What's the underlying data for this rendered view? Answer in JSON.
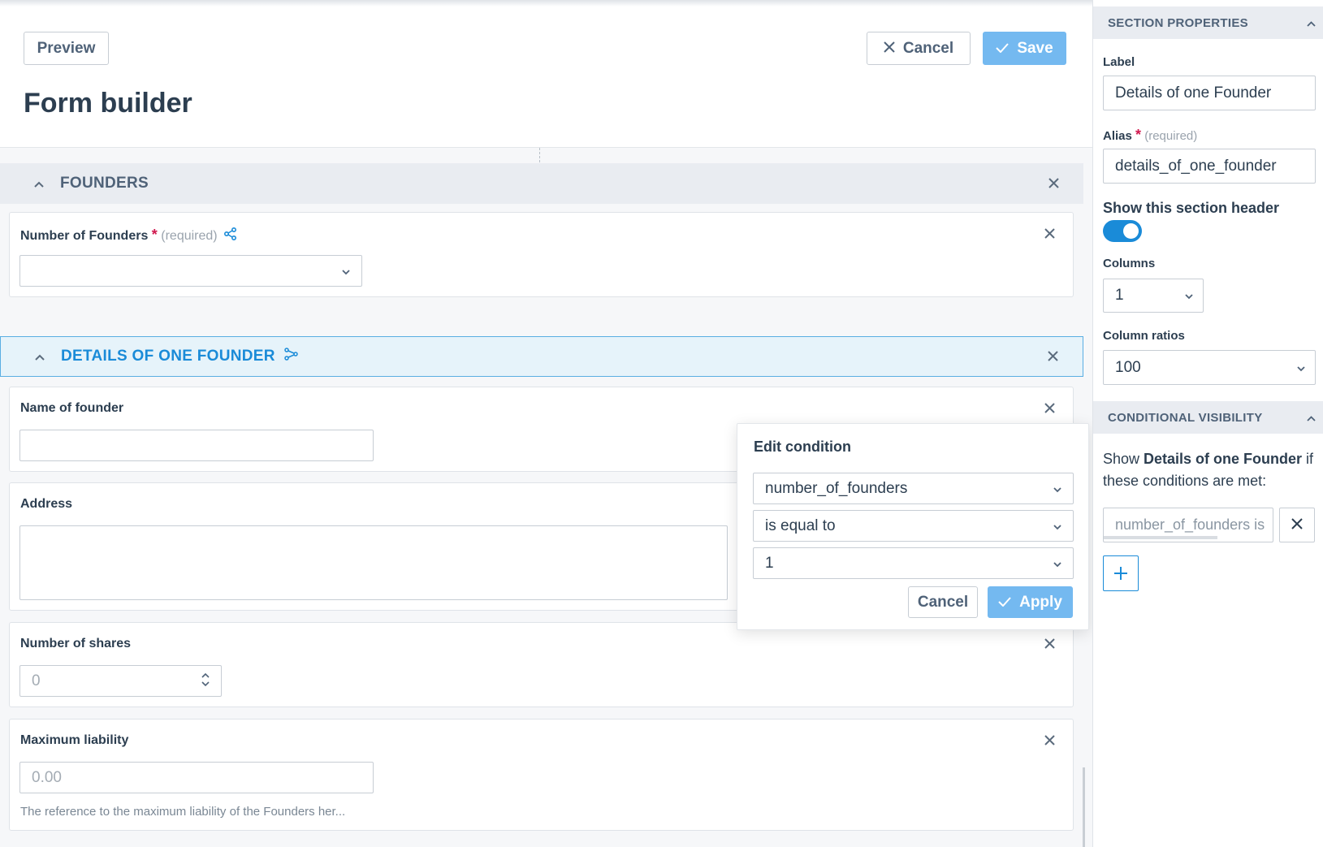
{
  "header": {
    "preview_label": "Preview",
    "cancel_label": "Cancel",
    "save_label": "Save",
    "title": "Form builder"
  },
  "sections": [
    {
      "title": "FOUNDERS",
      "fields": [
        {
          "label": "Number of Founders",
          "required_mark": "*",
          "required_text": "(required)",
          "value": ""
        }
      ]
    },
    {
      "title": "DETAILS OF ONE FOUNDER",
      "fields": [
        {
          "label": "Name of founder",
          "value": ""
        },
        {
          "label": "Address",
          "value": ""
        },
        {
          "label": "Number of shares",
          "placeholder": "0"
        },
        {
          "label": "Maximum liability",
          "placeholder": "0.00",
          "helper": "The reference to the maximum liability of the Founders her..."
        }
      ]
    }
  ],
  "edit_condition": {
    "title": "Edit condition",
    "field": "number_of_founders",
    "operator": "is equal to",
    "value": "1",
    "cancel_label": "Cancel",
    "apply_label": "Apply"
  },
  "panel": {
    "section_properties_title": "SECTION PROPERTIES",
    "label_label": "Label",
    "label_value": "Details of one Founder",
    "alias_label": "Alias",
    "alias_required_mark": "*",
    "alias_required_text": "(required)",
    "alias_value": "details_of_one_founder",
    "show_header_label": "Show this section header",
    "show_header_on": true,
    "columns_label": "Columns",
    "columns_value": "1",
    "column_ratios_label": "Column ratios",
    "column_ratios_value": "100",
    "conditional_visibility_title": "CONDITIONAL VISIBILITY",
    "cv_prefix": "Show ",
    "cv_section_name": "Details of one Founder",
    "cv_suffix": " if these conditions are met:",
    "condition_chip": "number_of_founders is"
  },
  "colors": {
    "accent": "#1a8bd8",
    "primary_button": "#74b9f0",
    "required": "#d0184e"
  }
}
